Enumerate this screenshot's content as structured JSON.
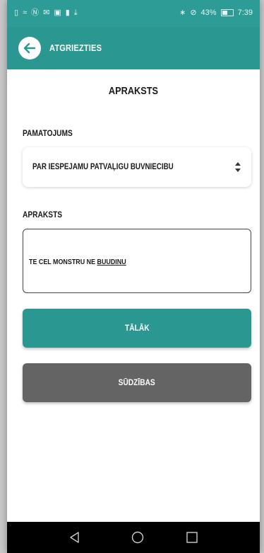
{
  "status_bar": {
    "left_icons": [
      "sim-icon",
      "wifi-icon",
      "nfc-icon",
      "mail-icon",
      "image-icon",
      "notification-icon",
      "download-icon"
    ],
    "battery_percent": "43%",
    "time": "7:39"
  },
  "app_bar": {
    "back_label": "ATGRIEZTIES"
  },
  "page": {
    "title": "APRAKSTS"
  },
  "form": {
    "reason_label": "PAMATOJUMS",
    "reason_value": "PAR IESPĒJAMU PATVAĻĪGU BŪVNIECĪBU",
    "description_label": "APRAKSTS",
    "description_text_prefix": "TE CEL MONSTRU NE ",
    "description_text_typo": "BUUDINU"
  },
  "buttons": {
    "next_label": "TĀLĀK",
    "complaints_label": "SŪDZĪBAS"
  },
  "colors": {
    "accent": "#2a9891",
    "status_bar": "#2d9c96",
    "secondary_button": "#646464"
  }
}
